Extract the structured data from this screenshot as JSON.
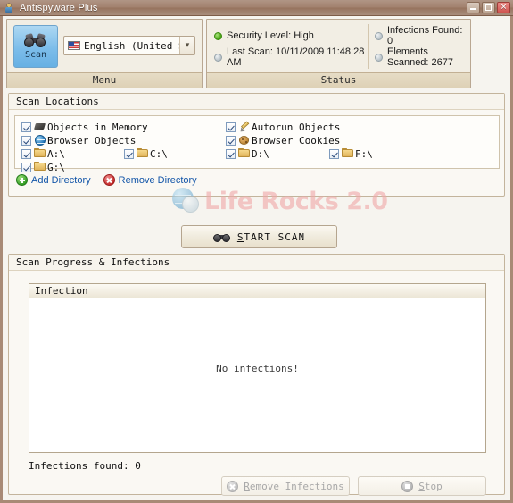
{
  "window": {
    "title": "Antispyware Plus",
    "icon": "user-shield-icon",
    "controls": {
      "minimize": "minimize-button",
      "maximize": "maximize-button",
      "close": "close-button"
    }
  },
  "menu_panel": {
    "footer_label": "Menu",
    "scan_button_label": "Scan",
    "language": {
      "value": "English (United States)",
      "flag": "us-flag-icon",
      "arrow": "chevron-down-icon"
    }
  },
  "status_panel": {
    "footer_label": "Status",
    "items": [
      {
        "label": "Security Level: High",
        "indicator": "green"
      },
      {
        "label": "Last Scan: 10/11/2009 11:48:28 AM",
        "indicator": "gray"
      },
      {
        "label": "Infections Found: 0",
        "indicator": "gray"
      },
      {
        "label": "Elements Scanned: 2677",
        "indicator": "gray"
      }
    ]
  },
  "scan_locations": {
    "title": "Scan Locations",
    "items": [
      {
        "label": "Objects in Memory",
        "icon": "memory-chip-icon",
        "checked": true,
        "col": 0,
        "row": 0
      },
      {
        "label": "Browser Objects",
        "icon": "browser-globe-icon",
        "checked": true,
        "col": 0,
        "row": 1
      },
      {
        "label": "A:\\",
        "icon": "folder-icon",
        "checked": true,
        "col": 0,
        "row": 2
      },
      {
        "label": "G:\\",
        "icon": "folder-icon",
        "checked": true,
        "col": 0,
        "row": 3
      },
      {
        "label": "C:\\",
        "icon": "folder-icon",
        "checked": true,
        "col": 1,
        "row": 2
      },
      {
        "label": "Autorun Objects",
        "icon": "autorun-pencil-icon",
        "checked": true,
        "col": 2,
        "row": 0
      },
      {
        "label": "Browser Cookies",
        "icon": "cookie-icon",
        "checked": true,
        "col": 2,
        "row": 1
      },
      {
        "label": "D:\\",
        "icon": "folder-icon",
        "checked": true,
        "col": 2,
        "row": 2
      },
      {
        "label": "F:\\",
        "icon": "folder-icon",
        "checked": true,
        "col": 3,
        "row": 2
      }
    ],
    "add_directory_label": "Add Directory",
    "remove_directory_label": "Remove Directory"
  },
  "watermark": {
    "text": "Life Rocks 2.0"
  },
  "start_scan": {
    "label_prefix": "",
    "accel": "S",
    "label_rest": "TART SCAN",
    "icon": "binoculars-icon"
  },
  "progress": {
    "title": "Scan Progress & Infections",
    "list_header": "Infection",
    "empty_message": "No infections!",
    "infections_found_label": "Infections found: 0",
    "buttons": [
      {
        "accel": "R",
        "rest": "emove Infections",
        "icon": "remove-x-icon",
        "enabled": false
      },
      {
        "accel": "S",
        "rest": "top",
        "icon": "stop-square-icon",
        "enabled": false
      }
    ]
  },
  "colors": {
    "titlebar": "#a2816e",
    "window_border": "#a88a76",
    "panel_bg": "#f2eee4",
    "accent_blue": "#7cbdea",
    "status_green": "#45a310",
    "link_blue": "#1255a8",
    "watermark_pink": "#f0a9a9"
  }
}
